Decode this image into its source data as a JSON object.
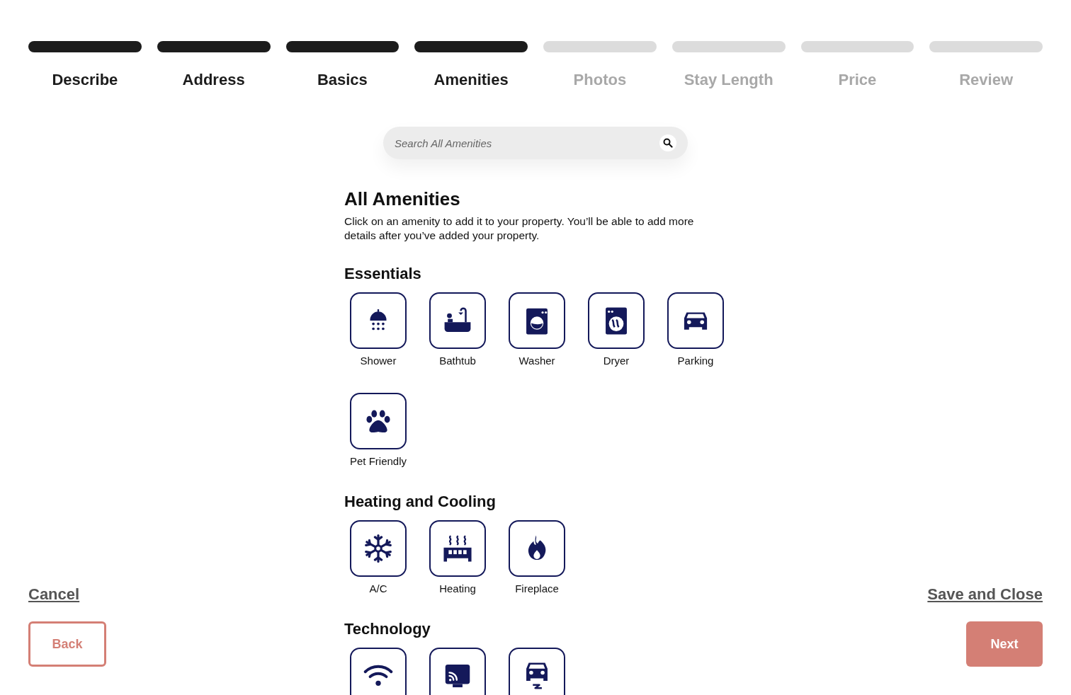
{
  "steps": [
    {
      "label": "Describe",
      "completed": true
    },
    {
      "label": "Address",
      "completed": true
    },
    {
      "label": "Basics",
      "completed": true
    },
    {
      "label": "Amenities",
      "completed": true
    },
    {
      "label": "Photos",
      "completed": false
    },
    {
      "label": "Stay Length",
      "completed": false
    },
    {
      "label": "Price",
      "completed": false
    },
    {
      "label": "Review",
      "completed": false
    }
  ],
  "search": {
    "placeholder": "Search All Amenities"
  },
  "title": "All Amenities",
  "description": "Click on an amenity to add it to your property. You’ll be able to add more details after you’ve added your property.",
  "sections": [
    {
      "heading": "Essentials",
      "amenities": [
        {
          "label": "Shower",
          "kind": "shower"
        },
        {
          "label": "Bathtub",
          "kind": "bathtub"
        },
        {
          "label": "Washer",
          "kind": "washer"
        },
        {
          "label": "Dryer",
          "kind": "dryer"
        },
        {
          "label": "Parking",
          "kind": "car"
        },
        {
          "label": "Pet Friendly",
          "kind": "paw"
        }
      ]
    },
    {
      "heading": "Heating and Cooling",
      "amenities": [
        {
          "label": "A/C",
          "kind": "snowflake"
        },
        {
          "label": "Heating",
          "kind": "heater"
        },
        {
          "label": "Fireplace",
          "kind": "flame"
        }
      ]
    },
    {
      "heading": "Technology",
      "amenities": [
        {
          "kind": "wifi"
        },
        {
          "kind": "cast"
        },
        {
          "kind": "ev"
        }
      ]
    }
  ],
  "footer": {
    "cancel": "Cancel",
    "save": "Save and Close",
    "back": "Back",
    "next": "Next"
  }
}
